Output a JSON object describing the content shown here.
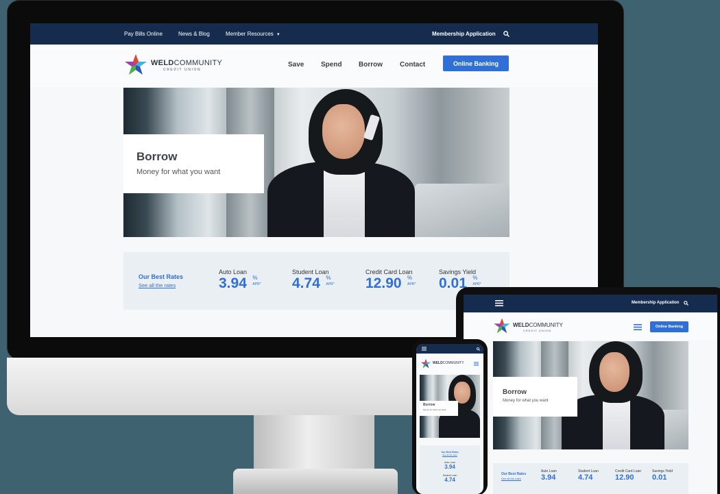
{
  "site": {
    "brand_main": "WELD",
    "brand_second": "COMMUNITY",
    "brand_sub": "CREDIT UNION"
  },
  "topbar": {
    "links": [
      "Pay Bills Online",
      "News & Blog",
      "Member Resources"
    ],
    "dropdown_caret": "▾",
    "membership": "Membership Application",
    "search_icon": "search-icon"
  },
  "nav": {
    "items": [
      "Save",
      "Spend",
      "Borrow",
      "Contact"
    ],
    "cta": "Online Banking"
  },
  "hero": {
    "title": "Borrow",
    "subtitle": "Money for what you want"
  },
  "rates": {
    "heading": "Our Best Rates",
    "link": "See all the rates",
    "unit_pct": "%",
    "unit_apr": "APR*",
    "items": [
      {
        "label": "Auto Loan",
        "value": "3.94"
      },
      {
        "label": "Student Loan",
        "value": "4.74"
      },
      {
        "label": "Credit Card Loan",
        "value": "12.90"
      },
      {
        "label": "Savings Yield",
        "value": "0.01"
      }
    ]
  },
  "tablet": {
    "membership": "Membership Application",
    "cta": "Online Banking",
    "hero_title": "Borrow",
    "hero_sub": "Money for what you want",
    "rates_heading": "Our Best Rates",
    "rates_link": "See all the rates",
    "labels": [
      "Auto Loan",
      "Student Loan",
      "Credit Card Loan",
      "Savings Yield"
    ],
    "values": [
      "3.94",
      "4.74",
      "12.90",
      "0.01"
    ]
  },
  "phone": {
    "hero_title": "Borrow",
    "hero_sub": "Money for what you want",
    "rates_heading": "Our Best Rates",
    "rates_link": "See all the rates",
    "labels": [
      "Auto Loan",
      "Student Loan"
    ],
    "values": [
      "3.94",
      "4.74"
    ]
  },
  "colors": {
    "accent": "#2f6fd6",
    "navy": "#152c4f",
    "background": "#3e6270"
  }
}
